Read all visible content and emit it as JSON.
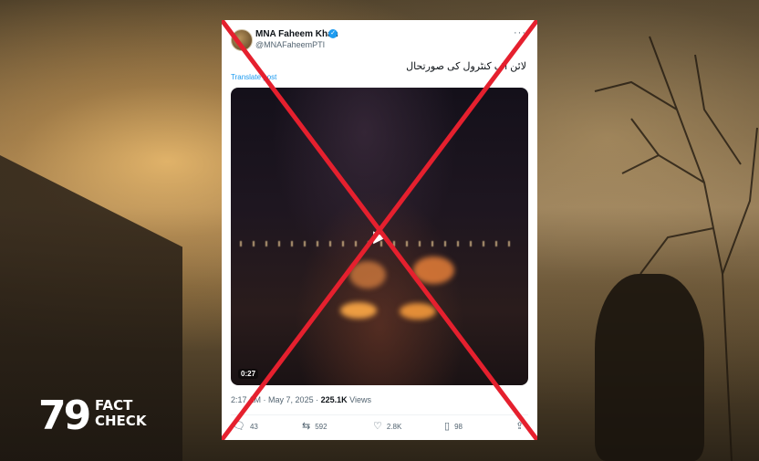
{
  "tweet": {
    "author_name": "MNA Faheem Khan",
    "handle": "@MNAFaheemPTI",
    "text": "لائن آف کنٹرول کی صورتحال",
    "translate_label": "Translate post",
    "video_duration": "0:27",
    "time": "2:17 AM",
    "date": "May 7, 2025",
    "views_count": "225.1K",
    "views_label": "Views",
    "replies": "43",
    "reposts": "592",
    "likes": "2.8K",
    "bookmarks": "98"
  },
  "brand": {
    "logo": "79",
    "line1": "FACT",
    "line2": "CHECK"
  },
  "icons": {
    "verified": "verified-badge-icon",
    "reply": "reply-icon",
    "repost": "repost-icon",
    "like": "heart-icon",
    "bookmark": "bookmark-icon",
    "share": "share-icon",
    "play": "play-icon",
    "more": "more-icon"
  },
  "colors": {
    "cross": "#e5202e",
    "link": "#1d9bf0",
    "verified": "#1d9bf0"
  }
}
